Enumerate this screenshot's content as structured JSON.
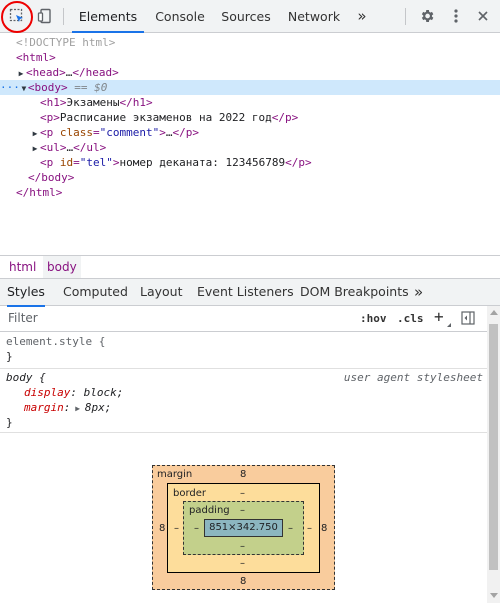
{
  "toolbar": {
    "tabs": [
      "Elements",
      "Console",
      "Sources",
      "Network"
    ],
    "more": "»"
  },
  "dom": {
    "doctype": "<!DOCTYPE html>",
    "html_open": "html",
    "head": "head",
    "body_tag": "body",
    "body_hint": "== $0",
    "h1_text": "Экзамены",
    "p1_text": "Расписание экзаменов на 2022 год",
    "p2_attr_name": "class",
    "p2_attr_value": "\"comment\"",
    "ul": "ul",
    "p3_attr_name": "id",
    "p3_attr_value": "\"tel\"",
    "p3_text": "номер деканата: 123456789",
    "ellipsis": "…"
  },
  "breadcrumbs": [
    "html",
    "body"
  ],
  "subtabs": [
    "Styles",
    "Computed",
    "Layout",
    "Event Listeners",
    "DOM Breakpoints"
  ],
  "filter": {
    "placeholder": "Filter",
    "hov": ":hov",
    "cls": ".cls",
    "plus": "+"
  },
  "styles": {
    "element_style": "element.style {",
    "close_brace": "}",
    "body_selector": "body {",
    "source": "user agent stylesheet",
    "props": [
      {
        "name": "display",
        "value": "block;"
      },
      {
        "name": "margin",
        "value": "8px;"
      }
    ]
  },
  "box_model": {
    "margin_label": "margin",
    "border_label": "border",
    "padding_label": "padding",
    "margin_top": "8",
    "margin_bottom": "8",
    "margin_left": "8",
    "margin_right": "8",
    "border_top": "–",
    "border_bottom": "–",
    "border_left": "–",
    "border_right": "–",
    "padding_top": "–",
    "padding_bottom": "–",
    "padding_left": "–",
    "padding_right": "–",
    "content": "851×342.750",
    "colors": {
      "margin": "#f9cc9d",
      "border": "#fddd9b",
      "padding": "#c3d08b",
      "content": "#8cb6c0"
    }
  }
}
